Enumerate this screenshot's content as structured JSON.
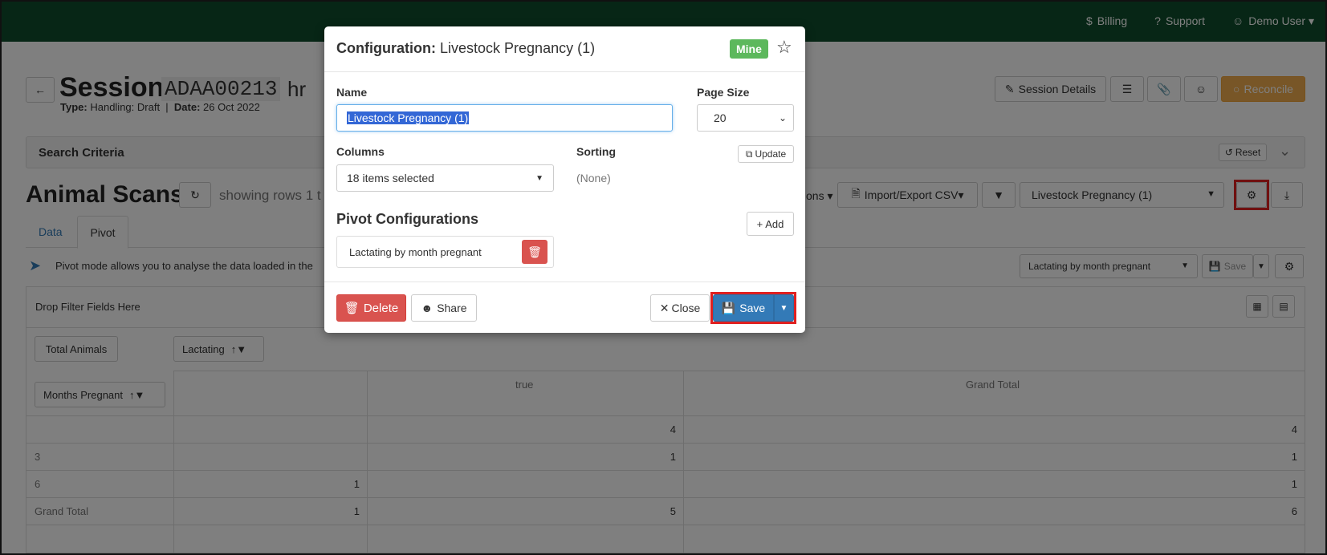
{
  "topnav": {
    "billing": "Billing",
    "support": "Support",
    "user": "Demo User"
  },
  "session": {
    "title": "Session",
    "code": "ADAA00213",
    "suffix": "hr",
    "type_label": "Type:",
    "type_value": "Handling: Draft",
    "date_label": "Date:",
    "date_value": "26 Oct 2022",
    "details_btn": "Session Details",
    "reconcile_btn": "Reconcile"
  },
  "search": {
    "title": "Search Criteria",
    "reset": "Reset"
  },
  "scans": {
    "title": "Animal Scans",
    "showing": "showing rows 1 t",
    "ons_fragment": "ons",
    "import_export": "Import/Export CSV",
    "config_select": "Livestock Pregnancy (1)",
    "tabs": [
      "Data",
      "Pivot"
    ],
    "pivot_info": "Pivot mode allows you to analyse the data loaded in the",
    "pivot_select": "Lactating by month pregnant",
    "pivot_save": "Save",
    "drop_filter": "Drop Filter Fields Here"
  },
  "pivot": {
    "value_field": "Total Animals",
    "col_field": "Lactating",
    "row_field": "Months Pregnant",
    "col_headers": [
      "true",
      "Grand Total"
    ],
    "rows": [
      {
        "label": "",
        "c1": "",
        "c2": "4",
        "total": "4"
      },
      {
        "label": "3",
        "c1": "",
        "c2": "1",
        "total": "1"
      },
      {
        "label": "6",
        "c1": "1",
        "c2": "",
        "total": "1"
      },
      {
        "label": "Grand Total",
        "c1": "1",
        "c2": "5",
        "total": "6"
      }
    ]
  },
  "modal": {
    "title_prefix": "Configuration:",
    "title_name": "Livestock Pregnancy (1)",
    "badge": "Mine",
    "name_label": "Name",
    "name_value": "Livestock Pregnancy (1)",
    "page_size_label": "Page Size",
    "page_size_value": "20",
    "columns_label": "Columns",
    "columns_value": "18 items selected",
    "sorting_label": "Sorting",
    "sorting_value": "(None)",
    "update_btn": "Update",
    "pivot_title": "Pivot Configurations",
    "add_btn": "Add",
    "pivot_item": "Lactating by month pregnant",
    "delete_btn": "Delete",
    "share_btn": "Share",
    "close_btn": "Close",
    "save_btn": "Save"
  },
  "colors": {
    "topbar": "#0e4d2c",
    "badge": "#5cb85c",
    "danger": "#d9534f",
    "primary": "#337ab7",
    "reconcile": "#f0ad4e",
    "highlight": "#e02020"
  }
}
